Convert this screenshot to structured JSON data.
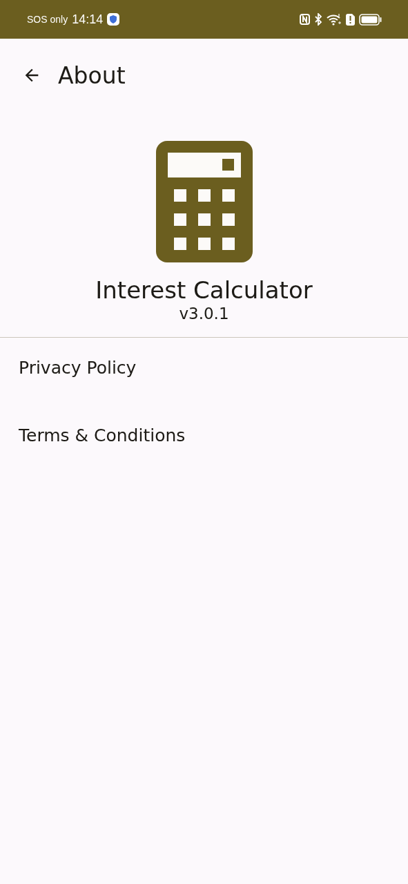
{
  "status_bar": {
    "carrier": "SOS only",
    "time": "14:14"
  },
  "app_bar": {
    "title": "About"
  },
  "app_info": {
    "name": "Interest Calculator",
    "version": "v3.0.1"
  },
  "links": [
    {
      "label": "Privacy Policy"
    },
    {
      "label": "Terms & Conditions"
    }
  ]
}
